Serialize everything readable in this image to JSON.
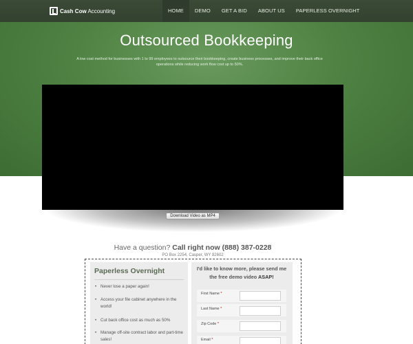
{
  "header": {
    "logo_bold": "Cash Cow",
    "logo_rest": " Accounting",
    "nav": [
      {
        "label": "HOME",
        "active": true
      },
      {
        "label": "DEMO",
        "active": false
      },
      {
        "label": "GET A BID",
        "active": false
      },
      {
        "label": "ABOUT US",
        "active": false
      },
      {
        "label": "PAPERLESS OVERNIGHT",
        "active": false
      }
    ]
  },
  "hero": {
    "title": "Outsourced Bookkeeping",
    "subtitle": "A low cost method for businesses with 1 to 99 employees to outsource their bookkeeping, create business processes, and improve their back office operations while reducing work flow cost up to 50%."
  },
  "video": {
    "download_label": "Download Video as MP4"
  },
  "contact": {
    "question": "Have a question? ",
    "call": "Call right now (888) 387-0228",
    "address": "PO Box 2254, Casper, WY 82602"
  },
  "left_panel": {
    "title": "Paperless Overnight",
    "bullets": [
      "Never lose a paper again!",
      "Access your file cabinet anywhere in the world!",
      "Cut back office cost as much as 50%",
      "Manage off-site contract labor and part-time sales!"
    ]
  },
  "form": {
    "heading_main": "I'd like to know more, please send me the free demo video ",
    "heading_strong": "ASAP!",
    "fields": [
      {
        "label": "First Name",
        "required": "*"
      },
      {
        "label": "Last Name",
        "required": "*"
      },
      {
        "label": "Zip Code",
        "required": "*"
      },
      {
        "label": "Email",
        "required": "*"
      }
    ]
  },
  "colors": {
    "nav_bg": "#334230",
    "hero_green": "#4f8243",
    "panel_bg": "#ececec"
  }
}
